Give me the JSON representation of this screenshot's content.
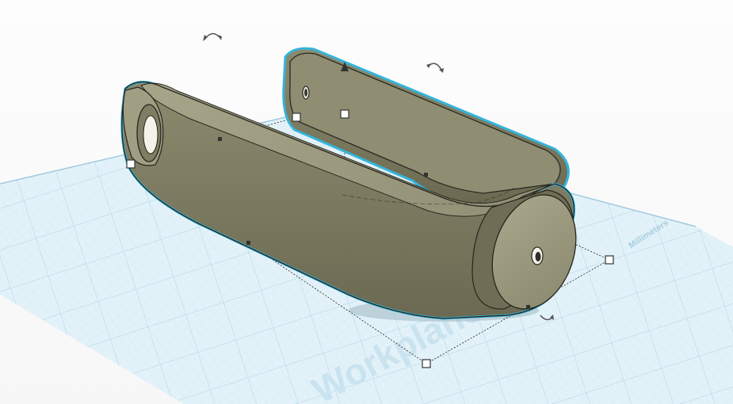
{
  "workplane": {
    "label": "Workplane",
    "units": "Millimeters"
  },
  "colors": {
    "grid_fill": "#dff0f8",
    "grid_line": "#b9dbea",
    "shape_fill": "#7f7d62",
    "shape_dark": "#5e5c48",
    "shape_light": "#b3b196",
    "selection_outline": "#35b4d9"
  },
  "icons": {
    "rotate": "rotate-arrow-icon",
    "lift": "lift-cone-icon"
  }
}
